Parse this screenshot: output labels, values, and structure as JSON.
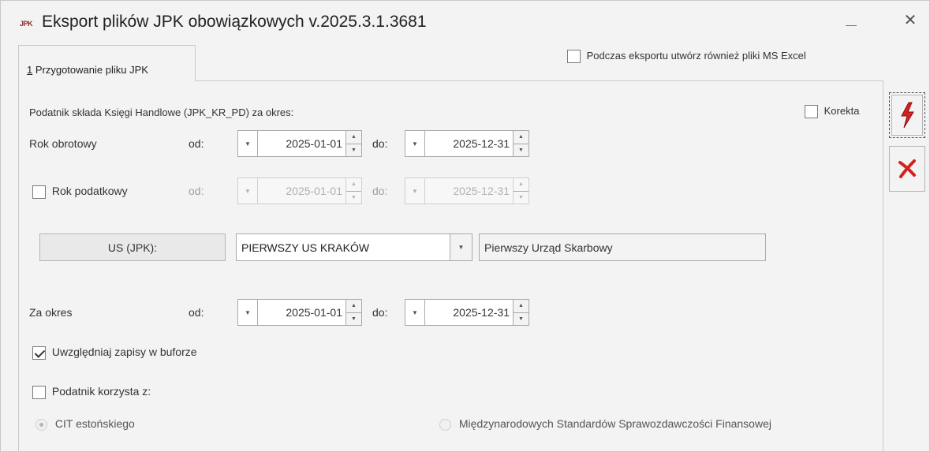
{
  "window": {
    "title": "Eksport plików JPK obowiązkowych v.2025.3.1.3681",
    "icon_text": "JPK"
  },
  "tabs": [
    {
      "number": "1",
      "label": " Przygotowanie pliku JPK"
    }
  ],
  "excel_option": {
    "label": "Podczas eksportu utwórz również pliki MS Excel",
    "checked": false
  },
  "form": {
    "header": "Podatnik składa Księgi Handlowe (JPK_KR_PD) za okres:",
    "korekta": {
      "label": "Korekta",
      "checked": false
    },
    "rok_obrotowy": {
      "label": "Rok obrotowy",
      "od_label": "od:",
      "od_value": "2025-01-01",
      "do_label": "do:",
      "do_value": "2025-12-31"
    },
    "rok_podatkowy": {
      "label": "Rok podatkowy",
      "checked": false,
      "od_label": "od:",
      "od_value": "2025-01-01",
      "do_label": "do:",
      "do_value": "2025-12-31"
    },
    "us": {
      "button_label": "US (JPK):",
      "selected": "PIERWSZY US KRAKÓW",
      "name": "Pierwszy Urząd Skarbowy"
    },
    "za_okres": {
      "label": "Za okres",
      "od_label": "od:",
      "od_value": "2025-01-01",
      "do_label": "do:",
      "do_value": "2025-12-31"
    },
    "bufor": {
      "label": "Uwzględniaj zapisy w buforze",
      "checked": true
    },
    "podatnik_korzysta": {
      "label": "Podatnik korzysta z:",
      "checked": false
    },
    "radio_cit": {
      "label": "CIT estońskiego",
      "selected": true
    },
    "radio_msr": {
      "label": "Międzynarodowych Standardów Sprawozdawczości Finansowej",
      "selected": false
    }
  },
  "colors": {
    "run_icon": "#d62020",
    "cancel_icon": "#d62020",
    "window_bg": "#f3f3f3"
  },
  "icons": {
    "run": "lightning-bolt-icon",
    "cancel": "red-x-icon"
  }
}
